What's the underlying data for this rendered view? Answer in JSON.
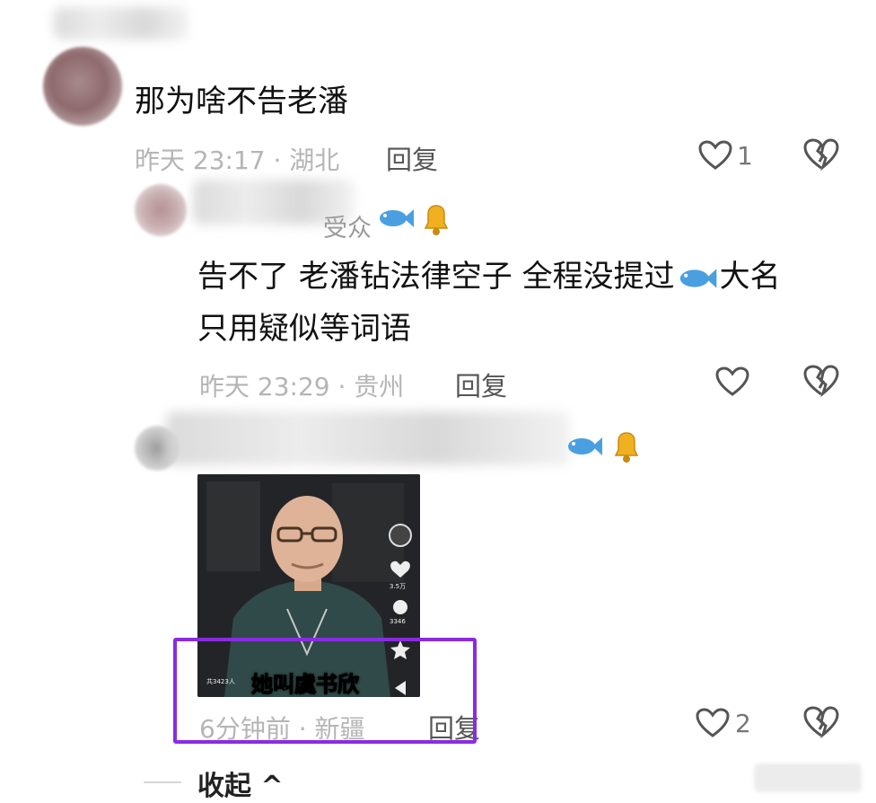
{
  "comment1": {
    "text": "那为啥不告老潘",
    "meta": "昨天 23:17 · 湖北",
    "reply": "回复",
    "likes": "1"
  },
  "comment2": {
    "name_suffix": "受众",
    "line1_a": "告不了 老潘钻法律空子 全程没提过",
    "line1_b": "大名",
    "line2": "只用疑似等词语",
    "meta": "昨天 23:29 · 贵州",
    "reply": "回复"
  },
  "comment3": {
    "video": {
      "caption": "她叫虞书欣",
      "like_count": "3.5万",
      "comment_count": "3346",
      "view_text": "共3423人"
    },
    "meta": "6分钟前 · 新疆",
    "reply": "回复",
    "likes": "2"
  },
  "collapse_label": "收起 ^",
  "colors": {
    "highlight": "#8a2be2"
  },
  "icons": [
    "heart-icon",
    "broken-heart-icon",
    "fish-icon",
    "bell-icon"
  ]
}
